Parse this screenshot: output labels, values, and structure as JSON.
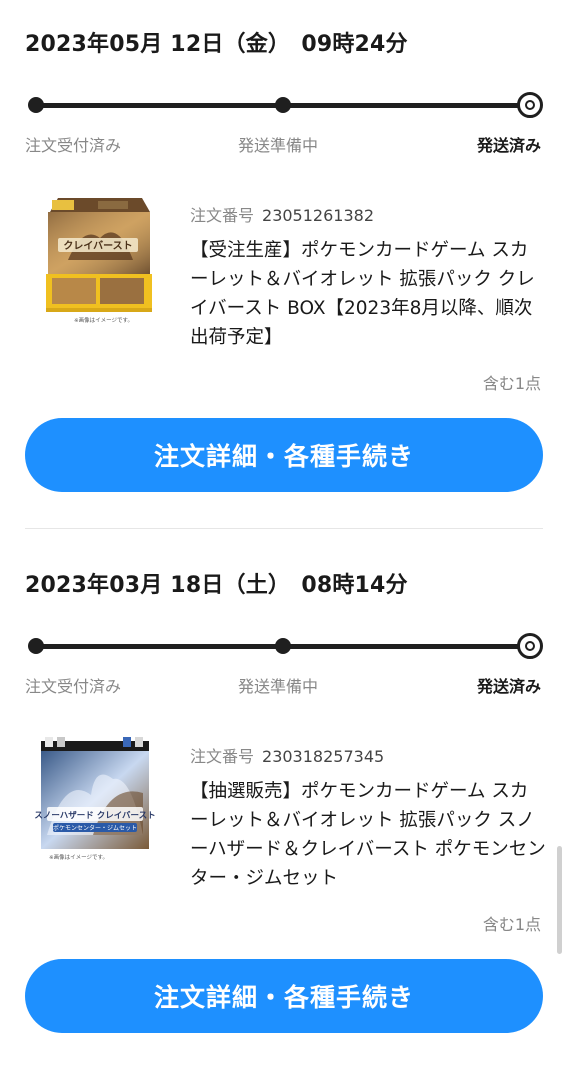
{
  "orders": [
    {
      "date": "2023年05月 12日（金）　09時24分",
      "steps": [
        "注文受付済み",
        "発送準備中",
        "発送済み"
      ],
      "order_no_label": "注文番号",
      "order_no": "23051261382",
      "product_name": "【受注生産】ポケモンカードゲーム スカーレット＆バイオレット 拡張パック クレイバースト BOX【2023年8月以降、順次出荷予定】",
      "quantity": "含む1点",
      "detail_button": "注文詳細・各種手続き",
      "thumb_title": "クレイバースト",
      "thumb_note": "※画像はイメージです。"
    },
    {
      "date": "2023年03月 18日（土）　08時14分",
      "steps": [
        "注文受付済み",
        "発送準備中",
        "発送済み"
      ],
      "order_no_label": "注文番号",
      "order_no": "230318257345",
      "product_name": "【抽選販売】ポケモンカードゲーム スカーレット＆バイオレット 拡張パック スノーハザード＆クレイバースト ポケモンセンター・ジムセット",
      "quantity": "含む1点",
      "detail_button": "注文詳細・各種手続き",
      "thumb_title": "スノーハザード クレイバースト",
      "thumb_sub": "ポケモンセンター・ジムセット",
      "thumb_note": "※画像はイメージです。"
    }
  ],
  "colors": {
    "accent": "#1e90ff",
    "muted": "#888888",
    "text": "#1a1a1a"
  }
}
